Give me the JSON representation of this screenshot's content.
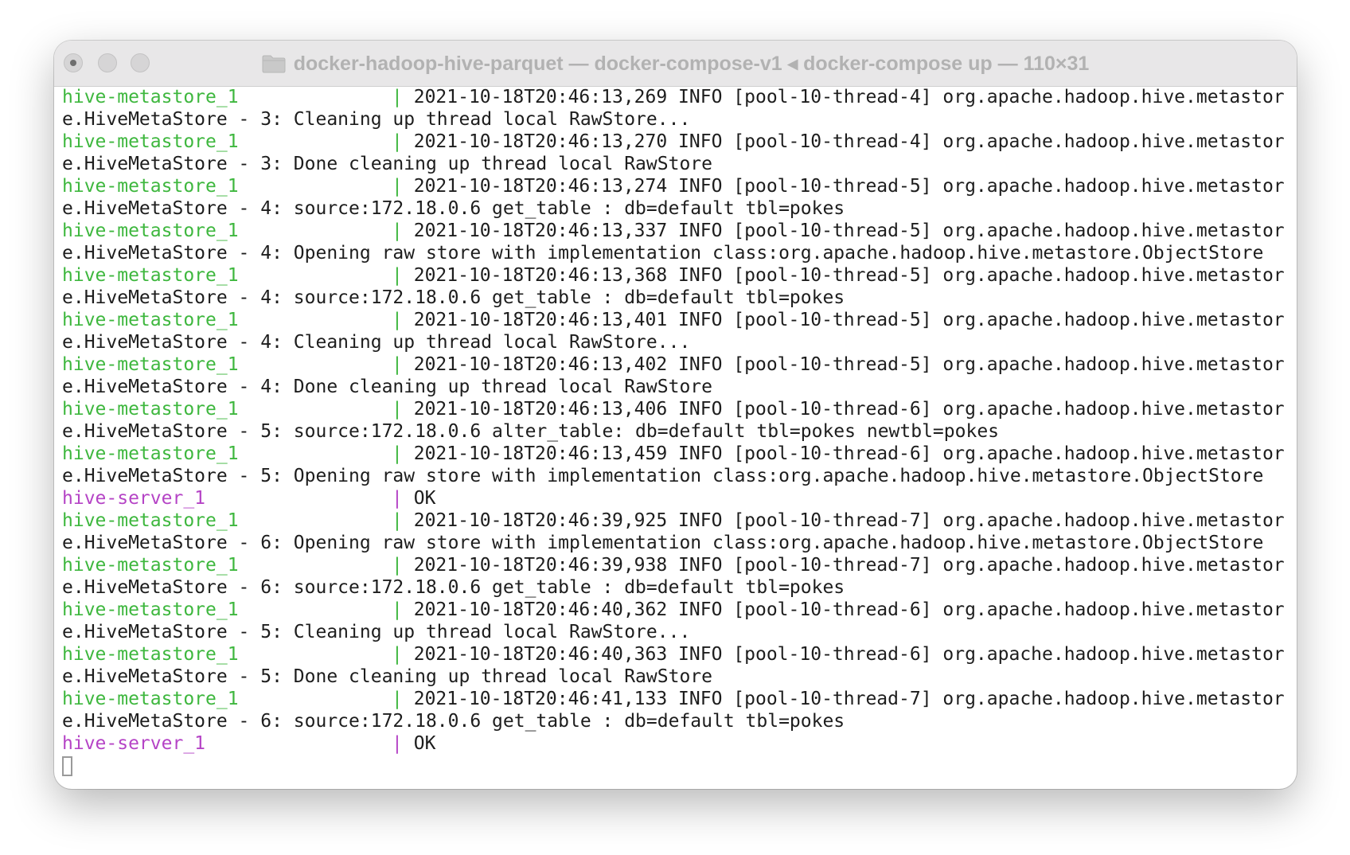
{
  "window": {
    "title": "docker-hadoop-hive-parquet — docker-compose-v1 ◂ docker-compose up — 110×31",
    "icon": "folder-icon",
    "colors": {
      "metastore": "#3eb73e",
      "server": "#b544c6",
      "text": "#1d1d1d"
    }
  },
  "terminal": {
    "lines": [
      {
        "svc": "hive-metastore_1",
        "color": "green",
        "msg": "2021-10-18T20:46:13,269 INFO [pool-10-thread-4] org.apache.hadoop.hive.metastor"
      },
      {
        "cont": "e.HiveMetaStore - 3: Cleaning up thread local RawStore..."
      },
      {
        "svc": "hive-metastore_1",
        "color": "green",
        "msg": "2021-10-18T20:46:13,270 INFO [pool-10-thread-4] org.apache.hadoop.hive.metastor"
      },
      {
        "cont": "e.HiveMetaStore - 3: Done cleaning up thread local RawStore"
      },
      {
        "svc": "hive-metastore_1",
        "color": "green",
        "msg": "2021-10-18T20:46:13,274 INFO [pool-10-thread-5] org.apache.hadoop.hive.metastor"
      },
      {
        "cont": "e.HiveMetaStore - 4: source:172.18.0.6 get_table : db=default tbl=pokes"
      },
      {
        "svc": "hive-metastore_1",
        "color": "green",
        "msg": "2021-10-18T20:46:13,337 INFO [pool-10-thread-5] org.apache.hadoop.hive.metastor"
      },
      {
        "cont": "e.HiveMetaStore - 4: Opening raw store with implementation class:org.apache.hadoop.hive.metastore.ObjectStore"
      },
      {
        "svc": "hive-metastore_1",
        "color": "green",
        "msg": "2021-10-18T20:46:13,368 INFO [pool-10-thread-5] org.apache.hadoop.hive.metastor"
      },
      {
        "cont": "e.HiveMetaStore - 4: source:172.18.0.6 get_table : db=default tbl=pokes"
      },
      {
        "svc": "hive-metastore_1",
        "color": "green",
        "msg": "2021-10-18T20:46:13,401 INFO [pool-10-thread-5] org.apache.hadoop.hive.metastor"
      },
      {
        "cont": "e.HiveMetaStore - 4: Cleaning up thread local RawStore..."
      },
      {
        "svc": "hive-metastore_1",
        "color": "green",
        "msg": "2021-10-18T20:46:13,402 INFO [pool-10-thread-5] org.apache.hadoop.hive.metastor"
      },
      {
        "cont": "e.HiveMetaStore - 4: Done cleaning up thread local RawStore"
      },
      {
        "svc": "hive-metastore_1",
        "color": "green",
        "msg": "2021-10-18T20:46:13,406 INFO [pool-10-thread-6] org.apache.hadoop.hive.metastor"
      },
      {
        "cont": "e.HiveMetaStore - 5: source:172.18.0.6 alter_table: db=default tbl=pokes newtbl=pokes"
      },
      {
        "svc": "hive-metastore_1",
        "color": "green",
        "msg": "2021-10-18T20:46:13,459 INFO [pool-10-thread-6] org.apache.hadoop.hive.metastor"
      },
      {
        "cont": "e.HiveMetaStore - 5: Opening raw store with implementation class:org.apache.hadoop.hive.metastore.ObjectStore"
      },
      {
        "svc": "hive-server_1",
        "color": "magenta",
        "msg": "OK"
      },
      {
        "svc": "hive-metastore_1",
        "color": "green",
        "msg": "2021-10-18T20:46:39,925 INFO [pool-10-thread-7] org.apache.hadoop.hive.metastor"
      },
      {
        "cont": "e.HiveMetaStore - 6: Opening raw store with implementation class:org.apache.hadoop.hive.metastore.ObjectStore"
      },
      {
        "svc": "hive-metastore_1",
        "color": "green",
        "msg": "2021-10-18T20:46:39,938 INFO [pool-10-thread-7] org.apache.hadoop.hive.metastor"
      },
      {
        "cont": "e.HiveMetaStore - 6: source:172.18.0.6 get_table : db=default tbl=pokes"
      },
      {
        "svc": "hive-metastore_1",
        "color": "green",
        "msg": "2021-10-18T20:46:40,362 INFO [pool-10-thread-6] org.apache.hadoop.hive.metastor"
      },
      {
        "cont": "e.HiveMetaStore - 5: Cleaning up thread local RawStore..."
      },
      {
        "svc": "hive-metastore_1",
        "color": "green",
        "msg": "2021-10-18T20:46:40,363 INFO [pool-10-thread-6] org.apache.hadoop.hive.metastor"
      },
      {
        "cont": "e.HiveMetaStore - 5: Done cleaning up thread local RawStore"
      },
      {
        "svc": "hive-metastore_1",
        "color": "green",
        "msg": "2021-10-18T20:46:41,133 INFO [pool-10-thread-7] org.apache.hadoop.hive.metastor"
      },
      {
        "cont": "e.HiveMetaStore - 6: source:172.18.0.6 get_table : db=default tbl=pokes"
      },
      {
        "svc": "hive-server_1",
        "color": "magenta",
        "msg": "OK"
      }
    ],
    "separator": "|"
  }
}
